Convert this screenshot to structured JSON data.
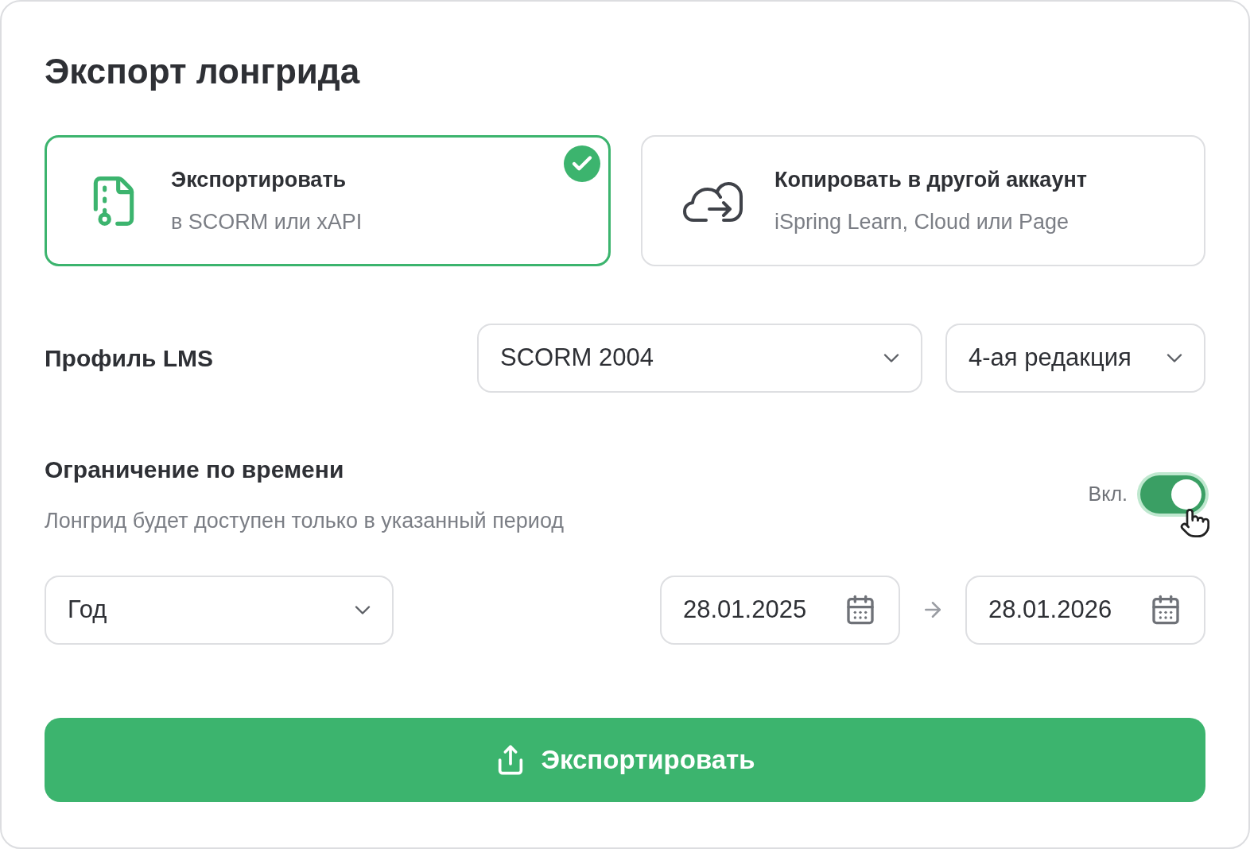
{
  "title": "Экспорт лонгрида",
  "options": [
    {
      "kind": "export",
      "title": "Экспортировать",
      "subtitle": "в SCORM или xAPI",
      "selected": true
    },
    {
      "kind": "copy",
      "title": "Копировать в другой аккаунт",
      "subtitle": "iSpring Learn, Cloud или Page",
      "selected": false
    }
  ],
  "lms": {
    "label": "Профиль LMS",
    "standard": "SCORM 2004",
    "edition": "4-ая редакция"
  },
  "time_limit": {
    "title": "Ограничение по времени",
    "description": "Лонгрид будет доступен только в указанный период",
    "toggle_label": "Вкл.",
    "on": true,
    "period": "Год",
    "start_date": "28.01.2025",
    "end_date": "28.01.2026"
  },
  "export_button": "Экспортировать"
}
